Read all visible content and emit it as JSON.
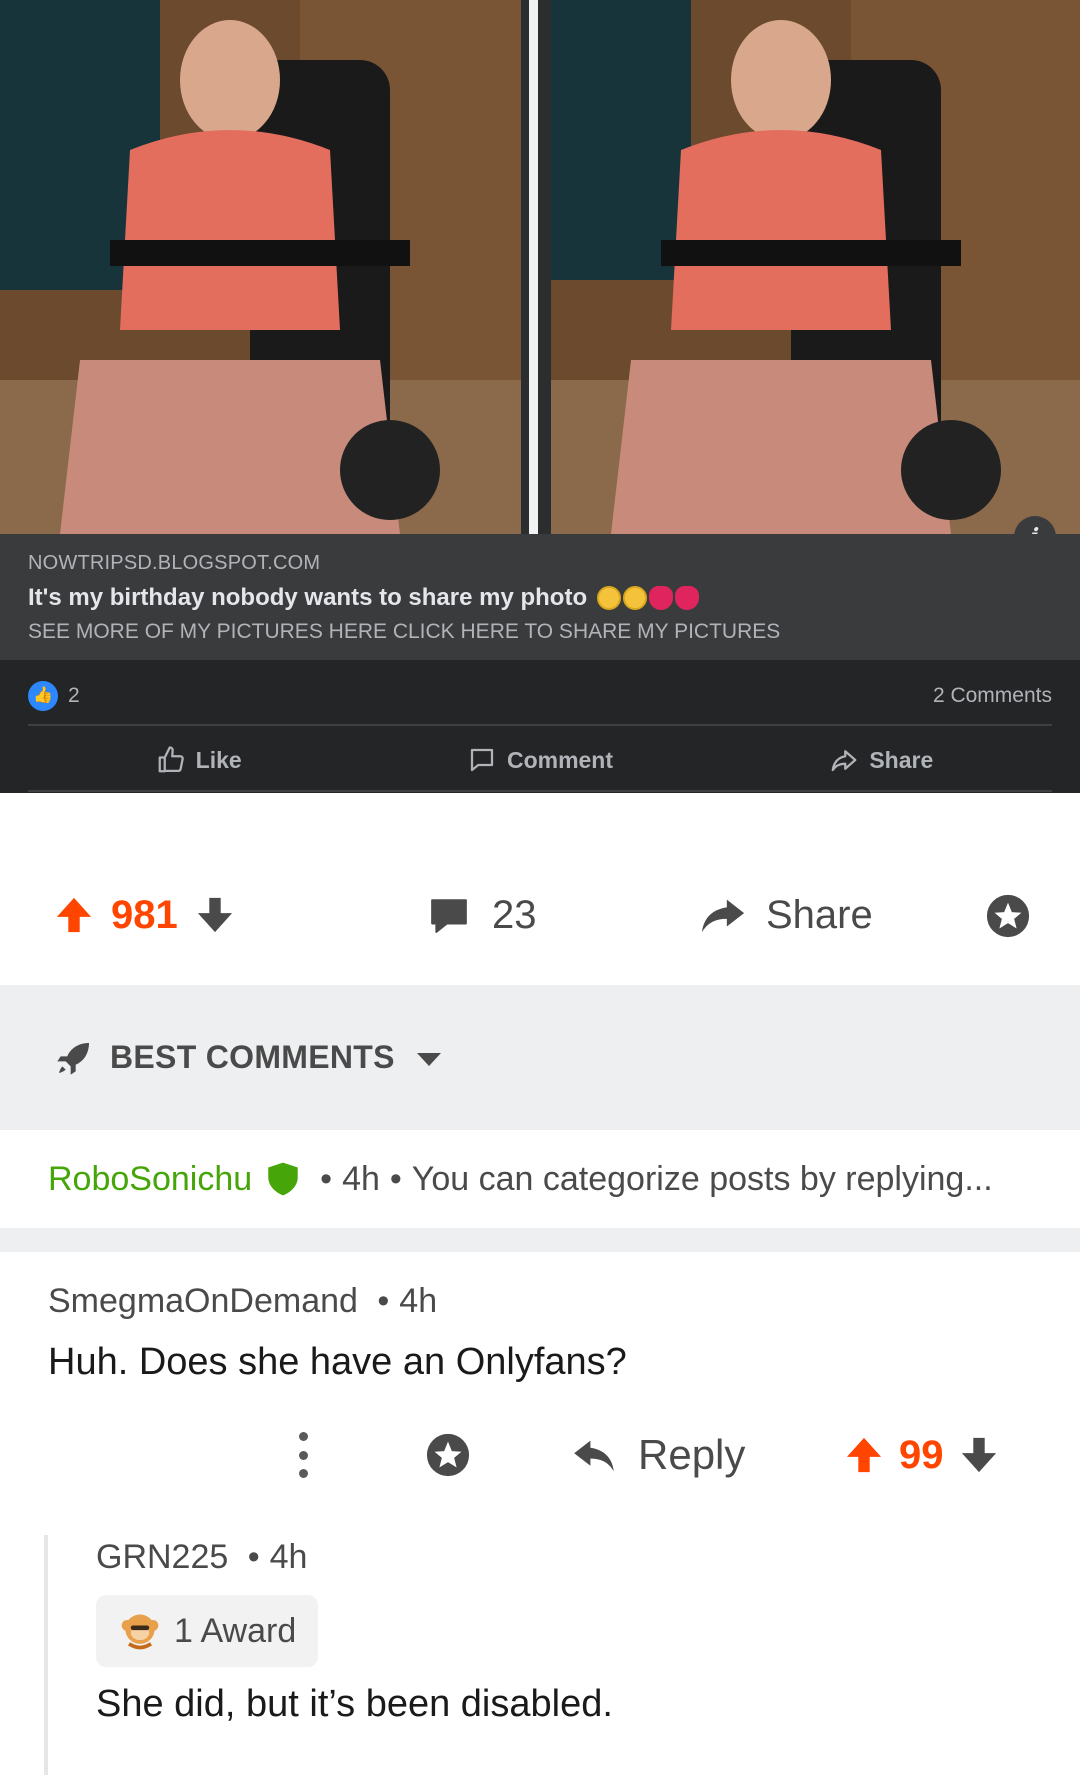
{
  "facebook_post": {
    "domain": "NOWTRIPSD.BLOGSPOT.COM",
    "title": "It's my birthday nobody wants to share my photo",
    "description": "SEE MORE OF MY PICTURES HERE CLICK HERE TO SHARE MY PICTURES",
    "like_count": "2",
    "comments_count": "2 Comments",
    "actions": {
      "like": "Like",
      "comment": "Comment",
      "share": "Share"
    },
    "info_icon": "i"
  },
  "post_bar": {
    "score": "981",
    "comment_count": "23",
    "share_label": "Share",
    "colors": {
      "upvoted": "#ff4500",
      "icon": "#4a4a4a"
    }
  },
  "sort": {
    "label": "BEST COMMENTS"
  },
  "mod_comment": {
    "author": "RoboSonichu",
    "age": "4h",
    "preview": "You can categorize posts by replying..."
  },
  "comment": {
    "author": "SmegmaOnDemand",
    "age": "4h",
    "body": "Huh. Does she have an Onlyfans?",
    "reply_label": "Reply",
    "score": "99"
  },
  "reply": {
    "author": "GRN225",
    "age": "4h",
    "award": "1 Award",
    "body": "She did, but it’s been disabled."
  }
}
